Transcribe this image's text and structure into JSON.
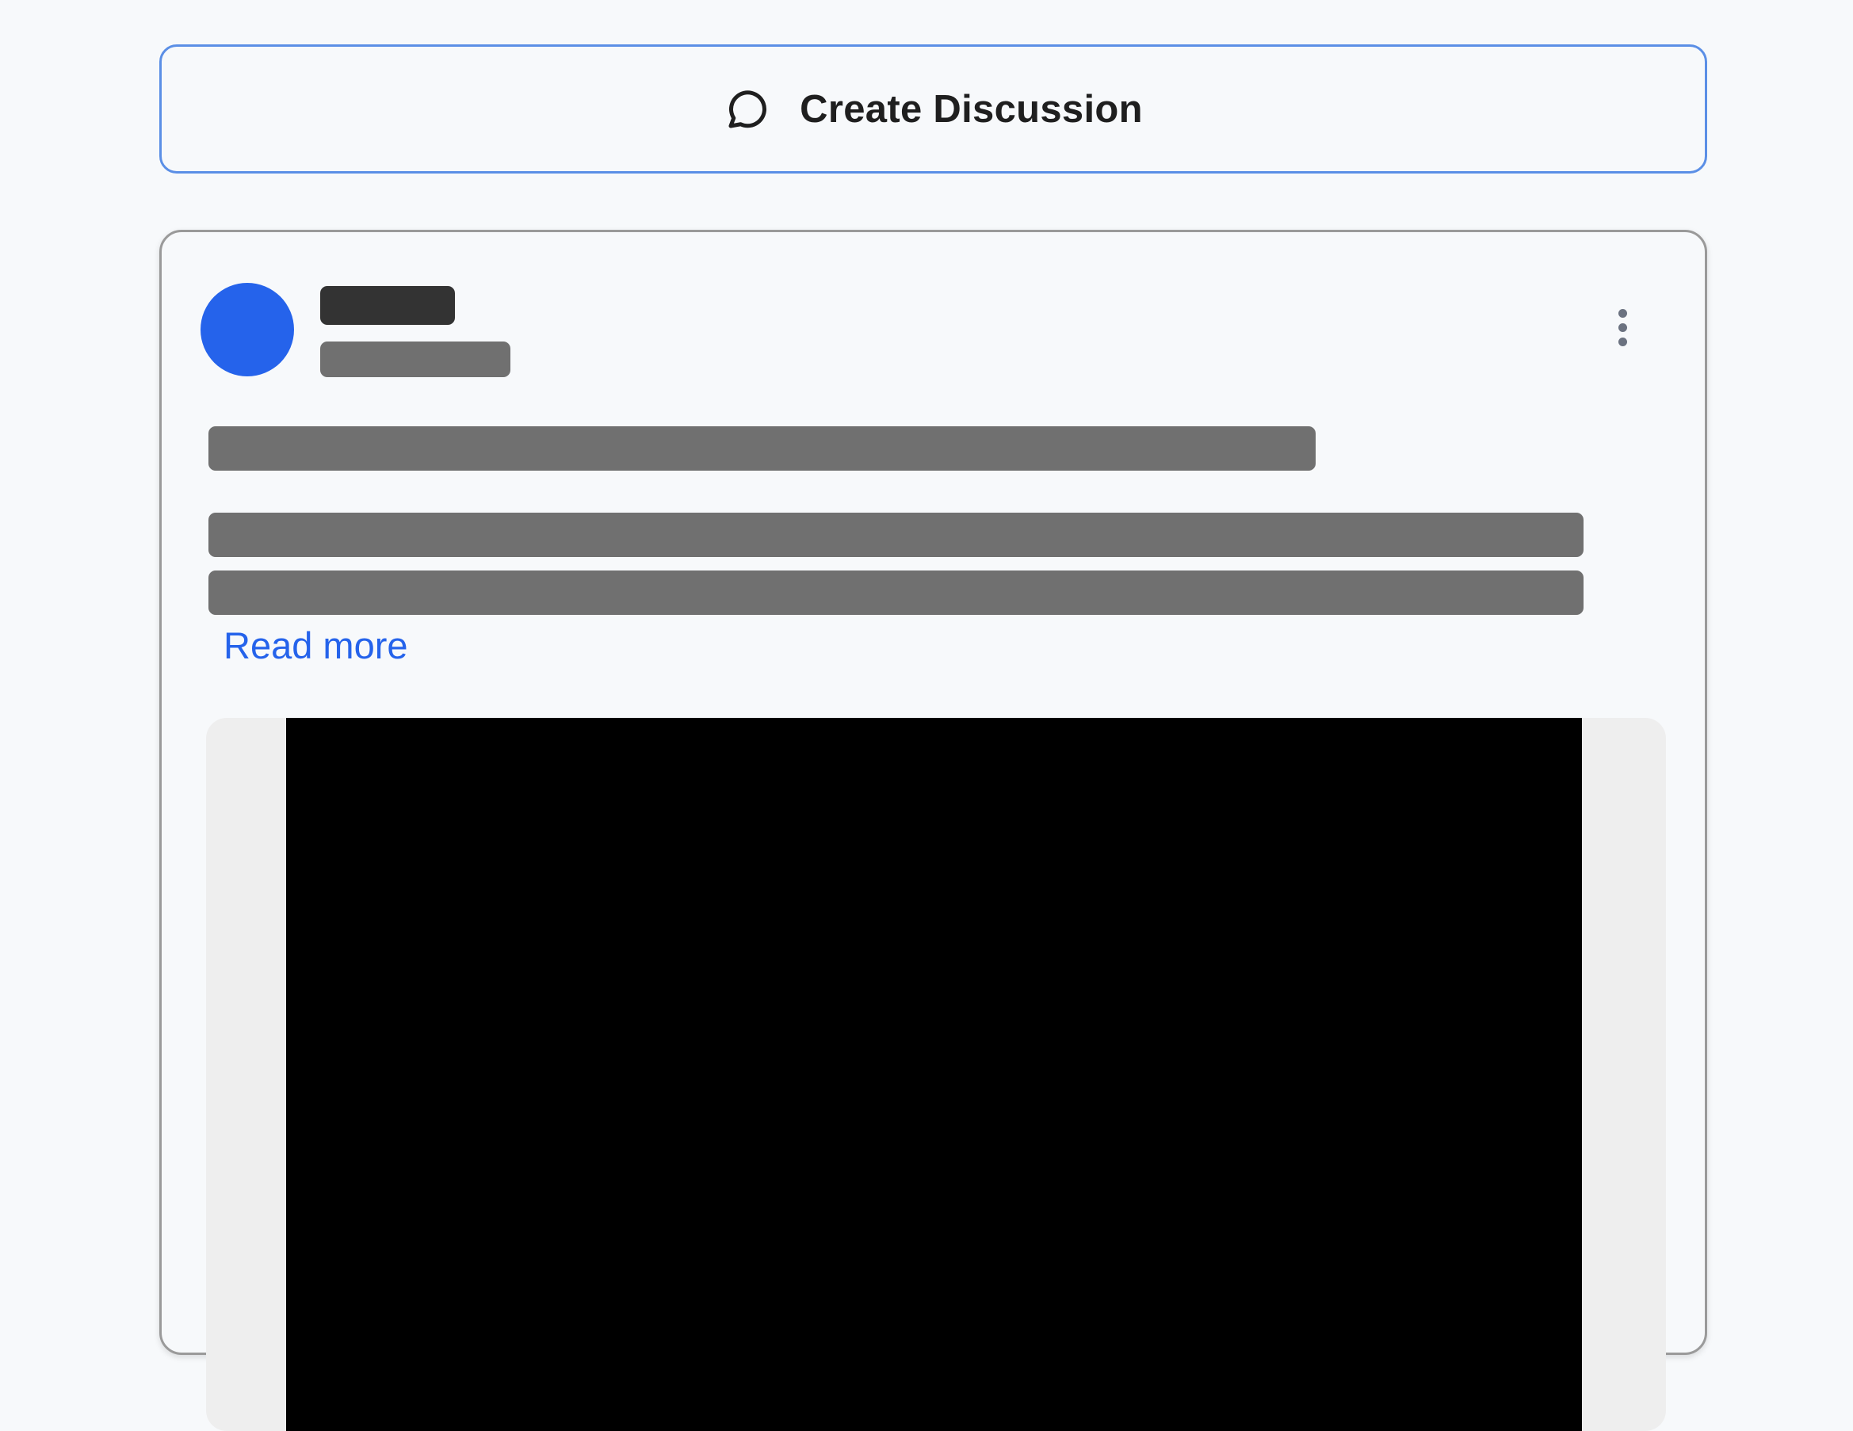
{
  "create_discussion": {
    "label": "Create Discussion",
    "icon": "chat-bubble-icon"
  },
  "post": {
    "avatar_color": "#2563eb",
    "author_name": "",
    "meta": "",
    "title": "",
    "body": "",
    "read_more_label": "Read more",
    "menu_icon": "more-vertical-icon"
  },
  "colors": {
    "accent": "#2563eb",
    "border_accent": "#5b8fe6",
    "background": "#f7f9fb",
    "redaction": "#707070"
  }
}
